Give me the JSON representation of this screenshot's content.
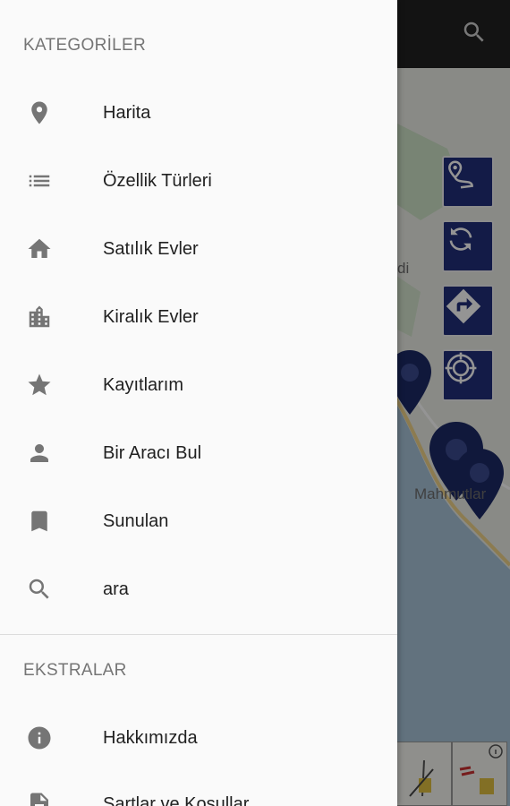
{
  "drawer": {
    "section_categories": "KATEGORİLER",
    "categories": [
      {
        "icon": "location-pin-icon",
        "label": "Harita"
      },
      {
        "icon": "list-icon",
        "label": "Özellik Türleri"
      },
      {
        "icon": "home-icon",
        "label": "Satılık Evler"
      },
      {
        "icon": "building-icon",
        "label": "Kiralık Evler"
      },
      {
        "icon": "star-icon",
        "label": "Kayıtlarım"
      },
      {
        "icon": "person-icon",
        "label": "Bir Aracı Bul"
      },
      {
        "icon": "bookmark-icon",
        "label": "Sunulan"
      },
      {
        "icon": "search-icon",
        "label": "ara"
      }
    ],
    "section_extras": "EKSTRALAR",
    "extras": [
      {
        "icon": "info-icon",
        "label": "Hakkımızda"
      },
      {
        "icon": "document-icon",
        "label": "Şartlar ve Koşullar"
      }
    ]
  },
  "map": {
    "labels": [
      "di",
      "Mahmutlar"
    ]
  },
  "colors": {
    "appbar": "#212121",
    "drawer_bg": "#fafafa",
    "icon_gray": "#757575",
    "fab_blue": "#22307a"
  }
}
